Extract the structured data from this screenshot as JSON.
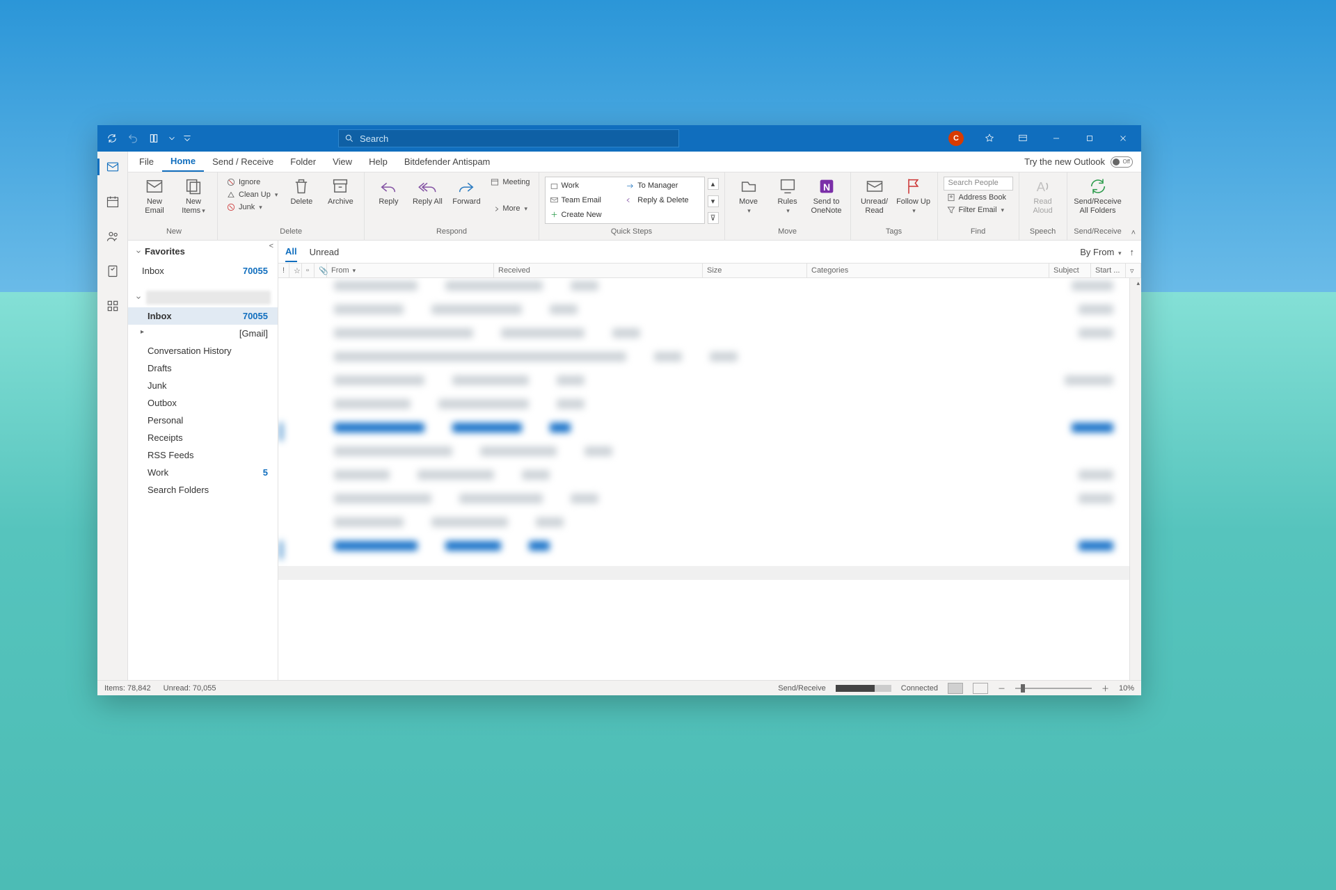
{
  "titlebar": {
    "search_placeholder": "Search",
    "avatar_initial": "C"
  },
  "menubar": {
    "tabs": [
      "File",
      "Home",
      "Send / Receive",
      "Folder",
      "View",
      "Help",
      "Bitdefender Antispam"
    ],
    "active": "Home",
    "try_new": "Try the new Outlook",
    "toggle_state": "Off"
  },
  "ribbon": {
    "new": {
      "label": "New",
      "new_email": "New Email",
      "new_items": "New Items"
    },
    "delete": {
      "label": "Delete",
      "ignore": "Ignore",
      "clean": "Clean Up",
      "junk": "Junk",
      "delete": "Delete",
      "archive": "Archive"
    },
    "respond": {
      "label": "Respond",
      "reply": "Reply",
      "reply_all": "Reply All",
      "forward": "Forward",
      "meeting": "Meeting",
      "more": "More"
    },
    "quick": {
      "label": "Quick Steps",
      "work": "Work",
      "to_manager": "To Manager",
      "team": "Team Email",
      "reply_del": "Reply & Delete",
      "create": "Create New"
    },
    "move": {
      "label": "Move",
      "move": "Move",
      "rules": "Rules",
      "onenote": "Send to OneNote"
    },
    "tags": {
      "label": "Tags",
      "unread": "Unread/ Read",
      "follow": "Follow Up"
    },
    "find": {
      "label": "Find",
      "search_people": "Search People",
      "address": "Address Book",
      "filter": "Filter Email"
    },
    "speech": {
      "label": "Speech",
      "aloud": "Read Aloud"
    },
    "sendrec": {
      "label": "Send/Receive",
      "all": "Send/Receive All Folders"
    }
  },
  "nav": {
    "favorites_label": "Favorites",
    "fav_inbox": {
      "name": "Inbox",
      "count": "70055"
    },
    "folders": [
      {
        "name": "Inbox",
        "count": "70055",
        "selected": true
      },
      {
        "name": "[Gmail]",
        "expandable": true
      },
      {
        "name": "Conversation History"
      },
      {
        "name": "Drafts"
      },
      {
        "name": "Junk"
      },
      {
        "name": "Outbox"
      },
      {
        "name": "Personal"
      },
      {
        "name": "Receipts"
      },
      {
        "name": "RSS Feeds"
      },
      {
        "name": "Work",
        "count": "5"
      },
      {
        "name": "Search Folders"
      }
    ]
  },
  "msg": {
    "tabs": {
      "all": "All",
      "unread": "Unread"
    },
    "sort_label": "By From",
    "columns": {
      "from": "From",
      "received": "Received",
      "size": "Size",
      "categories": "Categories",
      "subject": "Subject",
      "start": "Start ..."
    }
  },
  "status": {
    "items": "Items: 78,842",
    "unread": "Unread: 70,055",
    "sendreceive": "Send/Receive",
    "connected": "Connected",
    "zoom": "10%"
  }
}
